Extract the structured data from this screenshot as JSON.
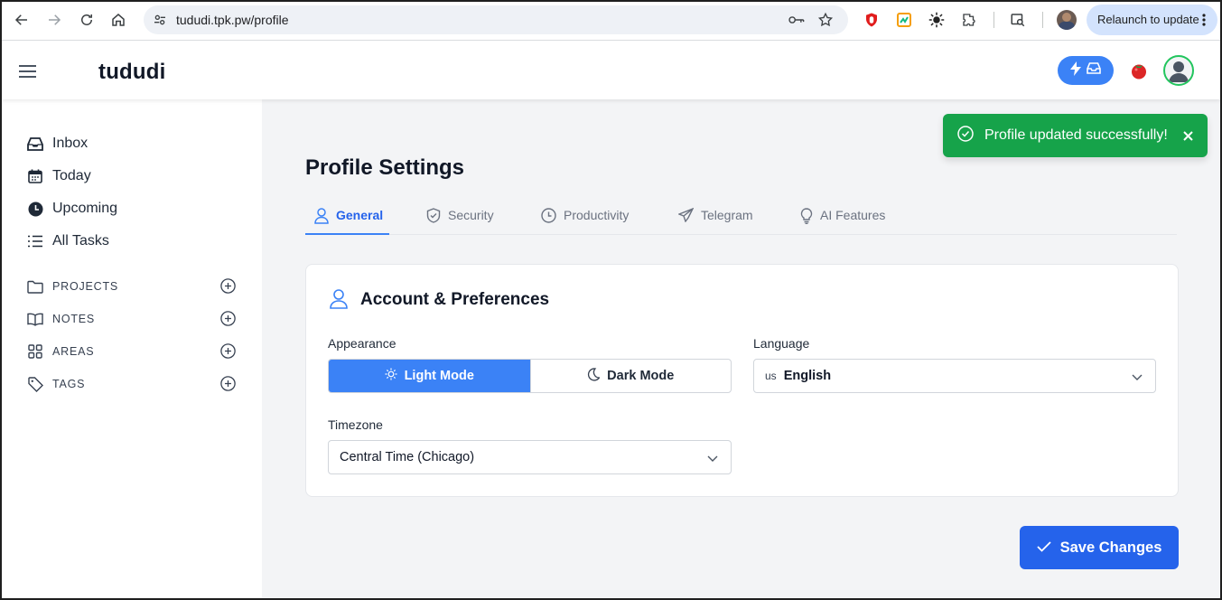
{
  "browser": {
    "url": "tududi.tpk.pw/profile",
    "relaunch_label": "Relaunch to update",
    "icons": [
      "back-icon",
      "forward-icon",
      "reload-icon",
      "home-icon",
      "site-settings-icon",
      "password-key-icon",
      "bookmark-star-icon",
      "extensions-icon",
      "search-tab-icon",
      "more-vert-icon"
    ]
  },
  "header": {
    "logo": "tududi",
    "accent": "#3b82f6",
    "avatar_ring": "#22c55e"
  },
  "sidebar": {
    "items": [
      {
        "label": "Inbox",
        "icon": "inbox-icon"
      },
      {
        "label": "Today",
        "icon": "calendar-icon"
      },
      {
        "label": "Upcoming",
        "icon": "clock-icon"
      },
      {
        "label": "All Tasks",
        "icon": "list-icon"
      }
    ],
    "sections": [
      {
        "label": "PROJECTS",
        "icon": "folder-icon"
      },
      {
        "label": "NOTES",
        "icon": "book-icon"
      },
      {
        "label": "AREAS",
        "icon": "grid-icon"
      },
      {
        "label": "TAGS",
        "icon": "tag-icon"
      }
    ]
  },
  "main": {
    "page_title": "Profile Settings",
    "tabs": [
      {
        "label": "General",
        "icon": "user-icon",
        "active": true
      },
      {
        "label": "Security",
        "icon": "shield-icon",
        "active": false
      },
      {
        "label": "Productivity",
        "icon": "clock-icon",
        "active": false
      },
      {
        "label": "Telegram",
        "icon": "paper-plane-icon",
        "active": false
      },
      {
        "label": "AI Features",
        "icon": "lightbulb-icon",
        "active": false
      }
    ],
    "card": {
      "title": "Account & Preferences",
      "appearance_label": "Appearance",
      "light_mode": "Light Mode",
      "dark_mode": "Dark Mode",
      "language_label": "Language",
      "language_flag": "us",
      "language_value": "English",
      "timezone_label": "Timezone",
      "timezone_value": "Central Time (Chicago)"
    },
    "save_label": "Save Changes"
  },
  "toast": {
    "message": "Profile updated successfully!",
    "color": "#16a34a"
  }
}
